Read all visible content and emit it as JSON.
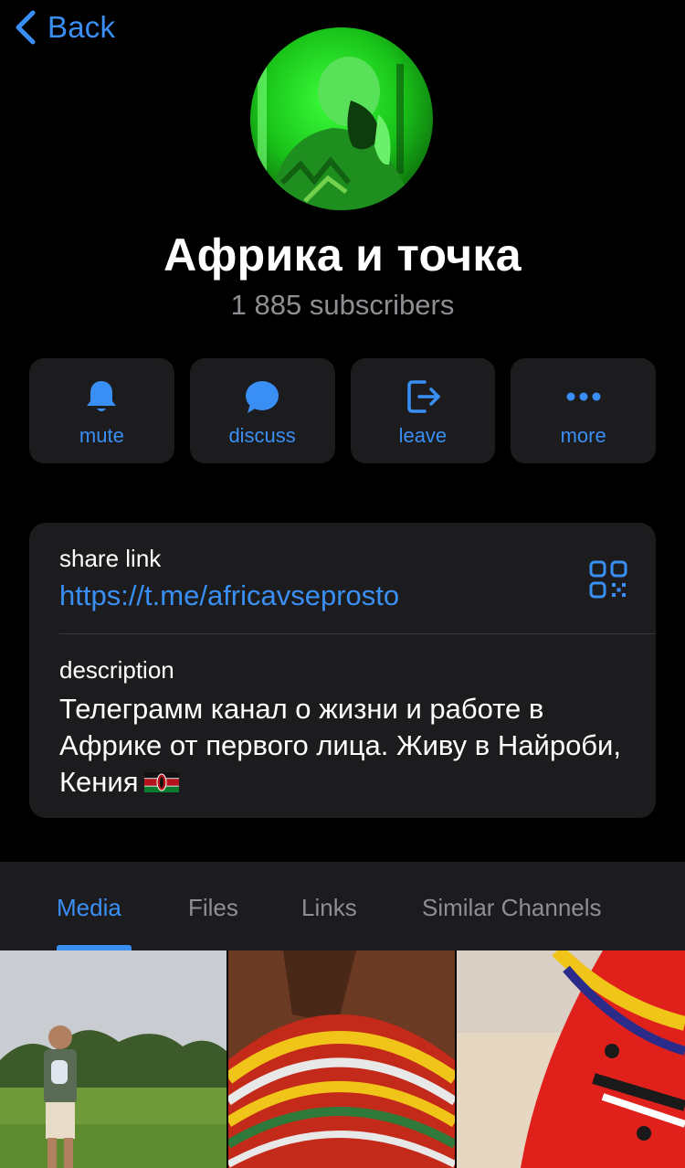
{
  "nav": {
    "back_label": "Back",
    "back_icon": "chevron-left-icon"
  },
  "channel": {
    "title": "Африка и точка",
    "subscribers": "1 885 subscribers"
  },
  "actions": [
    {
      "label": "mute",
      "icon": "bell-icon"
    },
    {
      "label": "discuss",
      "icon": "chat-bubble-icon"
    },
    {
      "label": "leave",
      "icon": "leave-icon"
    },
    {
      "label": "more",
      "icon": "more-dots-icon"
    }
  ],
  "info": {
    "share_label": "share link",
    "share_url": "https://t.me/africavseprosto",
    "qr_icon": "qr-code-icon",
    "description_label": "description",
    "description_text": "Телеграмм канал о жизни и работе в Африке от первого лица. Живу в Найроби, Кения",
    "description_emoji": "kenya-flag-icon"
  },
  "tabs": [
    {
      "label": "Media",
      "active": true
    },
    {
      "label": "Files",
      "active": false
    },
    {
      "label": "Links",
      "active": false
    },
    {
      "label": "Similar Channels",
      "active": false
    }
  ],
  "colors": {
    "accent": "#3a8ff5",
    "background": "#000000",
    "card": "#1c1c1e",
    "secondary_text": "#8e8e93"
  }
}
